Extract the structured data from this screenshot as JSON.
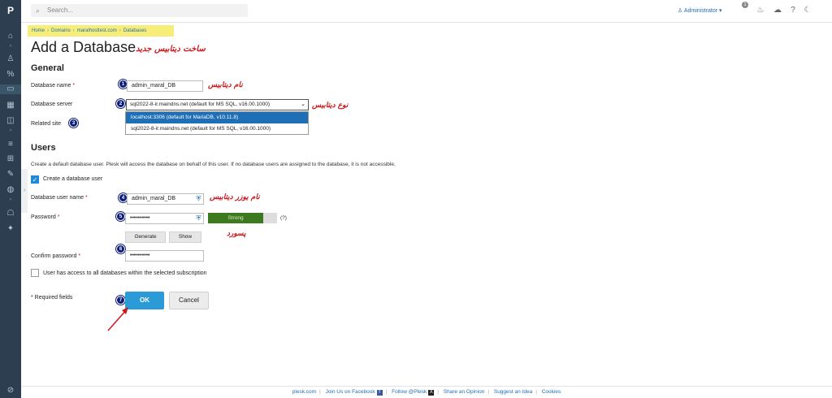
{
  "sidebar": {
    "logo": "P",
    "icons": [
      "home-icon",
      "user-icon",
      "percent-icon",
      "monitor-icon",
      "grid-icon",
      "panel-icon",
      "sliders-icon",
      "extensions-icon",
      "wordpress-icon",
      "globe-icon",
      "robot-icon",
      "wrench-icon",
      "help-circle-icon"
    ]
  },
  "topbar": {
    "search_placeholder": "Search...",
    "user": "Administrator",
    "notification_count": "1"
  },
  "breadcrumb": {
    "items": [
      "Home",
      "Domains",
      "maralhosttest.com",
      "Databases"
    ]
  },
  "page": {
    "title": "Add a Database",
    "title_annotation": "ساخت دیتابیس جدید"
  },
  "general": {
    "heading": "General",
    "db_name_label": "Database name",
    "db_name_value": "admin_maral_DB",
    "db_name_annotation": "نام دیتابیس",
    "server_label": "Database server",
    "server_value": "sql2022-8-ir.maindns.net (default for MS SQL, v16.00.1000)",
    "server_annotation": "نوع دیتابیس",
    "server_options": [
      "localhost:3306 (default for MariaDB, v10.11.8)",
      "sql2022-8-ir.maindns.net (default for MS SQL, v16.00.1000)"
    ],
    "related_site_label": "Related site"
  },
  "users": {
    "heading": "Users",
    "description": "Create a default database user. Plesk will access the database on behalf of this user. If no database users are assigned to the database, it is not accessible.",
    "create_user_label": "Create a database user",
    "username_label": "Database user name",
    "username_value": "admin_maral_DB",
    "username_annotation": "نام یوزر دیتابیس",
    "password_label": "Password",
    "password_value": "••••••••••",
    "password_strength": "Strong",
    "strength_level": 0.8,
    "help": "(?)",
    "generate_label": "Generate",
    "show_label": "Show",
    "password_annotation": "پسورد",
    "confirm_label": "Confirm password",
    "confirm_value": "••••••••••",
    "all_dbs_label": "User has access to all databases within the selected subscription"
  },
  "form": {
    "required_note": "* Required fields",
    "ok_label": "OK",
    "cancel_label": "Cancel"
  },
  "steps": [
    "1",
    "2",
    "3",
    "4",
    "5",
    "6",
    "7"
  ],
  "footer": {
    "links": [
      "plesk.com",
      "Join Us on Facebook",
      "Follow @Plesk",
      "Share an Opinion",
      "Suggest an Idea",
      "Cookies"
    ]
  },
  "colors": {
    "sidebar": "#2c3e50",
    "accent": "#2a9bd6",
    "annotation": "#d0161b",
    "step_badge": "#0c1d7a",
    "strength": "#3d7a1f"
  }
}
